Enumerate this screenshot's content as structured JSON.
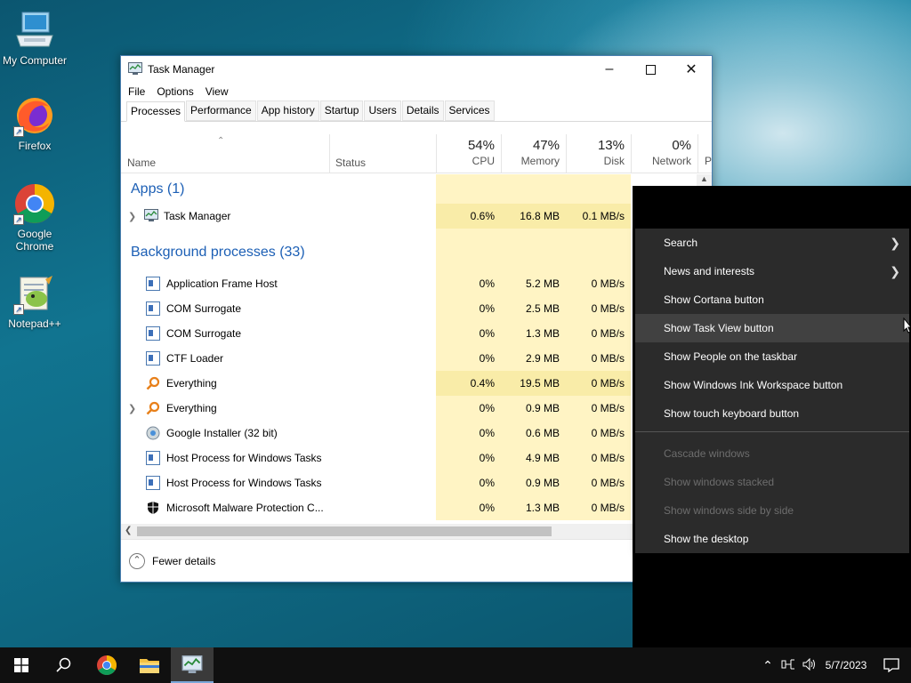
{
  "desktop": {
    "icons": [
      {
        "label": "My Computer"
      },
      {
        "label": "Firefox"
      },
      {
        "label": "Google Chrome"
      },
      {
        "label": "Notepad++"
      }
    ]
  },
  "window": {
    "title": "Task Manager",
    "menu": [
      "File",
      "Options",
      "View"
    ],
    "tabs": [
      "Processes",
      "Performance",
      "App history",
      "Startup",
      "Users",
      "Details",
      "Services"
    ],
    "active_tab": "Processes",
    "columns": {
      "name": "Name",
      "status": "Status",
      "cpu": {
        "pct": "54%",
        "label": "CPU"
      },
      "memory": {
        "pct": "47%",
        "label": "Memory"
      },
      "disk": {
        "pct": "13%",
        "label": "Disk"
      },
      "network": {
        "pct": "0%",
        "label": "Network"
      },
      "power_partial": "P"
    },
    "groups": {
      "apps": "Apps (1)",
      "background": "Background processes (33)"
    },
    "apps": [
      {
        "name": "Task Manager",
        "cpu": "0.6%",
        "memory": "16.8 MB",
        "disk": "0.1 MB/s",
        "expandable": true
      }
    ],
    "background": [
      {
        "name": "Application Frame Host",
        "cpu": "0%",
        "memory": "5.2 MB",
        "disk": "0 MB/s",
        "expandable": false
      },
      {
        "name": "COM Surrogate",
        "cpu": "0%",
        "memory": "2.5 MB",
        "disk": "0 MB/s",
        "expandable": false
      },
      {
        "name": "COM Surrogate",
        "cpu": "0%",
        "memory": "1.3 MB",
        "disk": "0 MB/s",
        "expandable": false
      },
      {
        "name": "CTF Loader",
        "cpu": "0%",
        "memory": "2.9 MB",
        "disk": "0 MB/s",
        "expandable": false
      },
      {
        "name": "Everything",
        "cpu": "0.4%",
        "memory": "19.5 MB",
        "disk": "0 MB/s",
        "expandable": false
      },
      {
        "name": "Everything",
        "cpu": "0%",
        "memory": "0.9 MB",
        "disk": "0 MB/s",
        "expandable": true
      },
      {
        "name": "Google Installer (32 bit)",
        "cpu": "0%",
        "memory": "0.6 MB",
        "disk": "0 MB/s",
        "expandable": false
      },
      {
        "name": "Host Process for Windows Tasks",
        "cpu": "0%",
        "memory": "4.9 MB",
        "disk": "0 MB/s",
        "expandable": false
      },
      {
        "name": "Host Process for Windows Tasks",
        "cpu": "0%",
        "memory": "0.9 MB",
        "disk": "0 MB/s",
        "expandable": false
      },
      {
        "name": "Microsoft Malware Protection C...",
        "cpu": "0%",
        "memory": "1.3 MB",
        "disk": "0 MB/s",
        "expandable": false
      }
    ],
    "footer": "Fewer details"
  },
  "context_menu": {
    "items": [
      {
        "label": "Search",
        "submenu": true,
        "disabled": false
      },
      {
        "label": "News and interests",
        "submenu": true,
        "disabled": false
      },
      {
        "label": "Show Cortana button",
        "submenu": false,
        "disabled": false
      },
      {
        "label": "Show Task View button",
        "submenu": false,
        "disabled": false,
        "hover": true
      },
      {
        "label": "Show People on the taskbar",
        "submenu": false,
        "disabled": false
      },
      {
        "label": "Show Windows Ink Workspace button",
        "submenu": false,
        "disabled": false
      },
      {
        "label": "Show touch keyboard button",
        "submenu": false,
        "disabled": false
      },
      {
        "sep": true
      },
      {
        "label": "Cascade windows",
        "submenu": false,
        "disabled": true
      },
      {
        "label": "Show windows stacked",
        "submenu": false,
        "disabled": true
      },
      {
        "label": "Show windows side by side",
        "submenu": false,
        "disabled": true
      },
      {
        "label": "Show the desktop",
        "submenu": false,
        "disabled": false
      }
    ]
  },
  "taskbar": {
    "clock_date": "5/7/2023"
  }
}
